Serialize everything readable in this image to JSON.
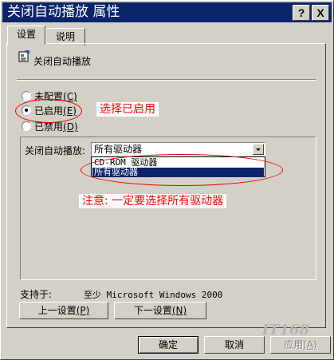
{
  "window": {
    "title": "关闭自动播放 属性",
    "help_button": "?",
    "close_button": "X"
  },
  "tabs": [
    {
      "label": "设置",
      "active": true
    },
    {
      "label": "说明",
      "active": false
    }
  ],
  "policy": {
    "name": "关闭自动播放",
    "icon": "policy-setting-icon"
  },
  "radio_options": [
    {
      "label": "未配置",
      "hotkey": "(C)",
      "selected": false
    },
    {
      "label": "已启用",
      "hotkey": "(E)",
      "selected": true
    },
    {
      "label": "已禁用",
      "hotkey": "(D)",
      "selected": false
    }
  ],
  "option": {
    "label": "关闭自动播放:",
    "selected_value": "所有驱动器",
    "dropdown_items": [
      {
        "label": "CD-ROM 驱动器",
        "highlighted": false
      },
      {
        "label": "所有驱动器",
        "highlighted": true
      }
    ]
  },
  "annotations": {
    "enabled_note": "选择已启用",
    "drive_note": "注意: 一定要选择所有驱动器",
    "color": "#ff0000"
  },
  "supported": {
    "label": "支持于:",
    "value": "至少 Microsoft Windows 2000"
  },
  "nav_buttons": {
    "prev": "上一设置",
    "prev_hotkey": "(P)",
    "next": "下一设置",
    "next_hotkey": "(N)"
  },
  "footer_buttons": {
    "ok": "确定",
    "cancel": "取消",
    "apply": "应用",
    "apply_hotkey": "(A)"
  },
  "watermark": "IT168",
  "colors": {
    "titlebar": "#0a246a",
    "face": "#d4d0c8",
    "selection": "#0a246a"
  }
}
